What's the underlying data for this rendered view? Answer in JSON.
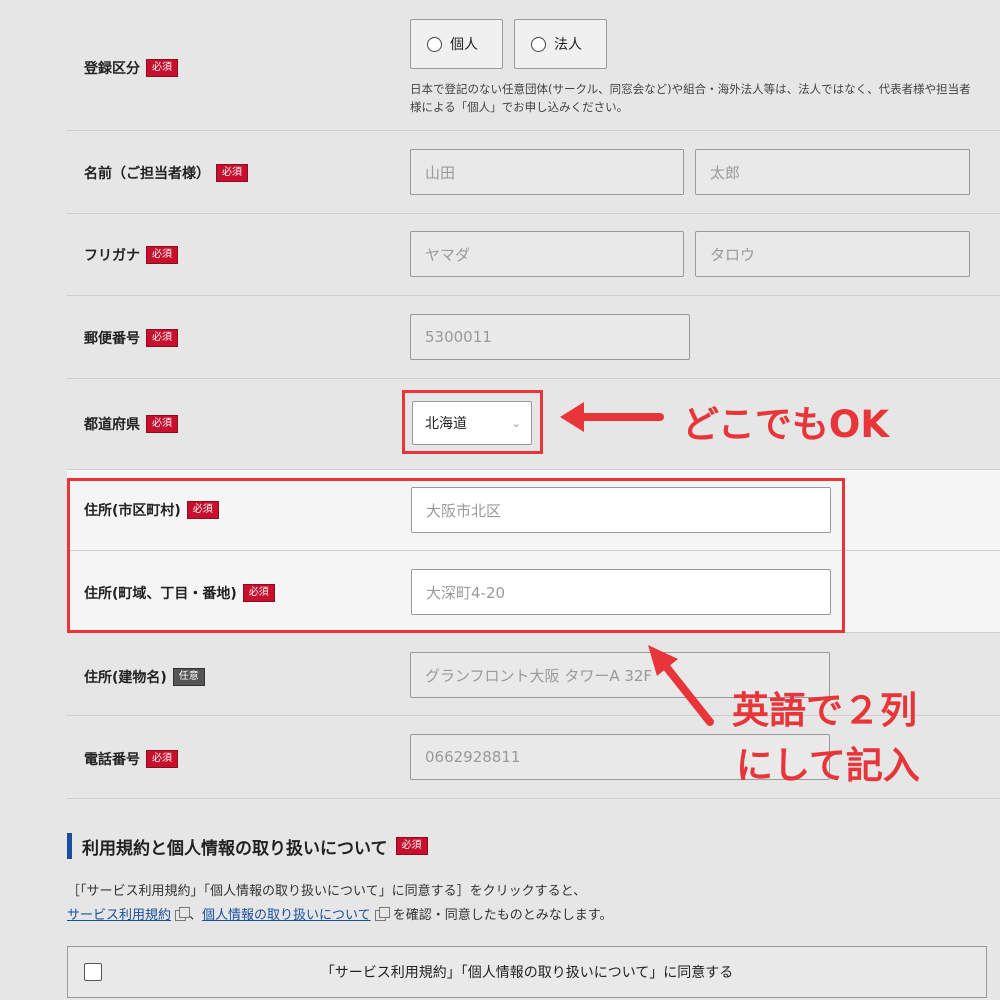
{
  "fields": {
    "registration_type": {
      "label": "登録区分",
      "badge": "必須",
      "options": [
        "個人",
        "法人"
      ],
      "note": "日本で登記のない任意団体(サークル、同窓会など)や組合・海外法人等は、法人ではなく、代表者様や担当者様による「個人」でお申し込みください。"
    },
    "name": {
      "label": "名前（ご担当者様）",
      "badge": "必須",
      "placeholder_last": "山田",
      "placeholder_first": "太郎"
    },
    "kana": {
      "label": "フリガナ",
      "badge": "必須",
      "placeholder_last": "ヤマダ",
      "placeholder_first": "タロウ"
    },
    "postal": {
      "label": "郵便番号",
      "badge": "必須",
      "placeholder": "5300011"
    },
    "prefecture": {
      "label": "都道府県",
      "badge": "必須",
      "selected": "北海道"
    },
    "city": {
      "label": "住所(市区町村)",
      "badge": "必須",
      "placeholder": "大阪市北区"
    },
    "street": {
      "label": "住所(町域、丁目・番地)",
      "badge": "必須",
      "placeholder": "大深町4-20"
    },
    "building": {
      "label": "住所(建物名)",
      "badge": "任意",
      "placeholder": "グランフロント大阪 タワーA 32F"
    },
    "phone": {
      "label": "電話番号",
      "badge": "必須",
      "placeholder": "0662928811"
    }
  },
  "annotations": {
    "prefecture_note": "どこでもOK",
    "address_note_line1": "英語で２列",
    "address_note_line2": "にして記入"
  },
  "terms": {
    "title": "利用規約と個人情報の取り扱いについて",
    "badge": "必須",
    "line1": "［「サービス利用規約」「個人情報の取り扱いについて」に同意する］をクリックすると、",
    "link1": "サービス利用規約",
    "separator": "、",
    "link2": "個人情報の取り扱いについて",
    "line2_suffix": "を確認・同意したものとみなします。",
    "agree_label": "「サービス利用規約」「個人情報の取り扱いについて」に同意する"
  },
  "colors": {
    "accent_red": "#e8353a",
    "required_badge": "#c8102e",
    "link_blue": "#1a4fa0"
  }
}
